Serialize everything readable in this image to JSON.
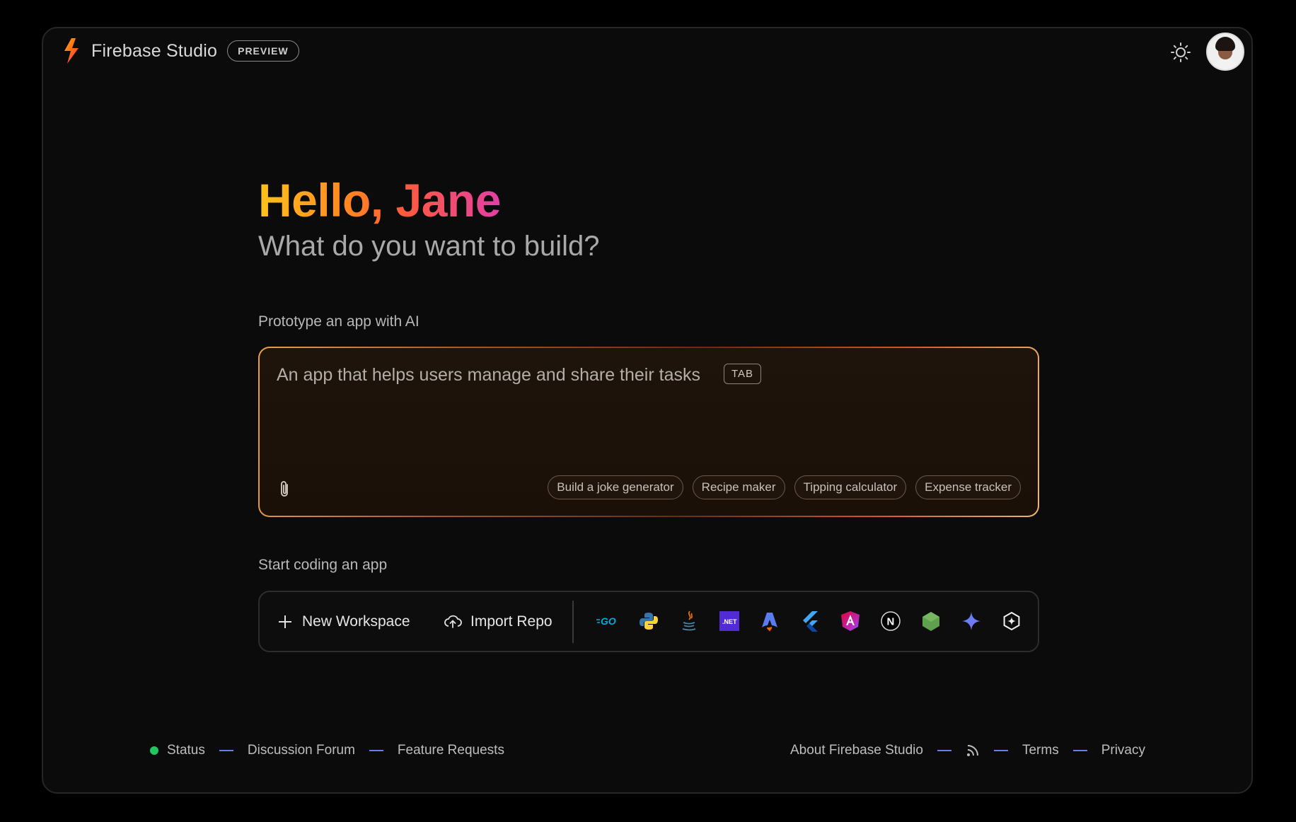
{
  "header": {
    "app_name": "Firebase Studio",
    "badge": "PREVIEW",
    "icons": {
      "logo": "firebase-flame-icon",
      "theme": "sun-icon",
      "avatar": "user-avatar"
    }
  },
  "hero": {
    "greeting": "Hello, Jane",
    "subheading": "What do you want to build?"
  },
  "prototype": {
    "label": "Prototype an app with AI",
    "placeholder": "An app that helps users manage and share their tasks",
    "tab_hint": "TAB",
    "attach_icon": "paperclip-icon",
    "suggestions": [
      "Build a joke generator",
      "Recipe maker",
      "Tipping calculator",
      "Expense tracker"
    ]
  },
  "coding": {
    "label": "Start coding an app",
    "new_workspace": "New Workspace",
    "import_repo": "Import Repo",
    "templates": [
      {
        "name": "go",
        "text": "GO",
        "color": "#00ADD8"
      },
      {
        "name": "python",
        "color": "#3776AB"
      },
      {
        "name": "java",
        "color": "#E76F00"
      },
      {
        "name": "dotnet",
        "text": ".NET",
        "color": "#512BD4"
      },
      {
        "name": "astro",
        "color": "#5b7cf0"
      },
      {
        "name": "flutter",
        "color": "#42A5F5"
      },
      {
        "name": "angular",
        "color": "#E535AB"
      },
      {
        "name": "nextjs",
        "text": "N",
        "color": "#ffffff"
      },
      {
        "name": "nodejs",
        "color": "#5FA04E"
      },
      {
        "name": "gemini",
        "color": "#4C8DF6"
      },
      {
        "name": "more-templates",
        "color": "#ffffff"
      }
    ]
  },
  "footer": {
    "left": [
      "Status",
      "Discussion Forum",
      "Feature Requests"
    ],
    "right": [
      "About Firebase Studio",
      "Terms",
      "Privacy"
    ],
    "status_color": "#22c55e",
    "rss_icon": "rss-icon"
  }
}
